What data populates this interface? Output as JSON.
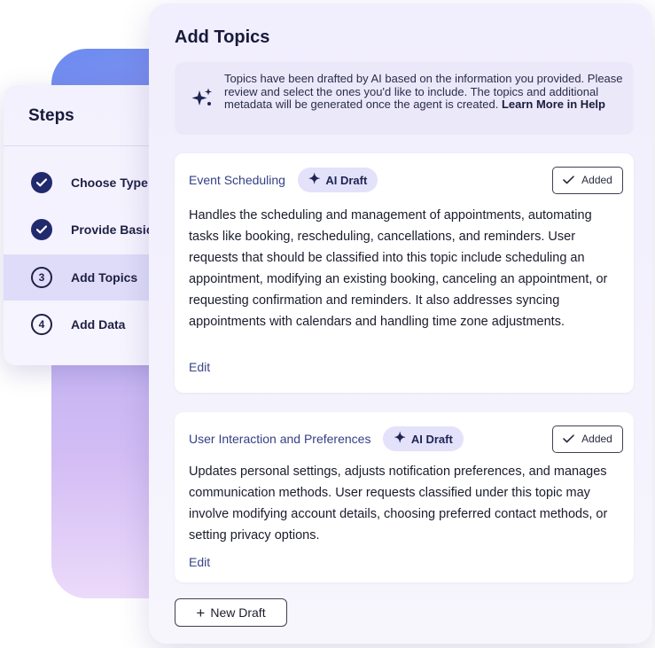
{
  "steps": {
    "title": "Steps",
    "items": [
      {
        "label": "Choose Type",
        "status": "complete"
      },
      {
        "label": "Provide Basic Information",
        "status": "complete"
      },
      {
        "label": "Add Topics",
        "number": "3",
        "status": "current"
      },
      {
        "label": "Add Data",
        "number": "4",
        "status": "upcoming"
      }
    ]
  },
  "main": {
    "title": "Add Topics",
    "info": {
      "icon": "sparkle-icon",
      "text": "Topics have been drafted by AI based on the information you provided. Please review and select the ones you'd like to include. The topics and additional metadata will be generated once the agent is created.",
      "link": "Learn More in Help"
    },
    "topics": [
      {
        "title": "Event Scheduling",
        "badge": "AI Draft",
        "added_label": "Added",
        "description": "Handles the scheduling and management of appointments, automating tasks like booking, rescheduling, cancellations, and reminders. User requests that should be classified into this topic include scheduling an appointment, modifying an existing booking, canceling an appointment, or requesting confirmation and reminders. It also addresses syncing appointments with calendars and handling time zone adjustments.",
        "edit_label": "Edit"
      },
      {
        "title": "User Interaction and Preferences",
        "badge": "AI Draft",
        "added_label": "Added",
        "description": "Updates personal settings, adjusts notification preferences, and manages communication methods. User requests classified under this topic may involve modifying account details, choosing preferred contact methods, or setting privacy options.",
        "edit_label": "Edit"
      }
    ],
    "new_draft_label": "New Draft"
  },
  "colors": {
    "accent_navy": "#222a6e",
    "badge_bg": "#e3e2fa",
    "panel_bg": "#f1eefd"
  }
}
